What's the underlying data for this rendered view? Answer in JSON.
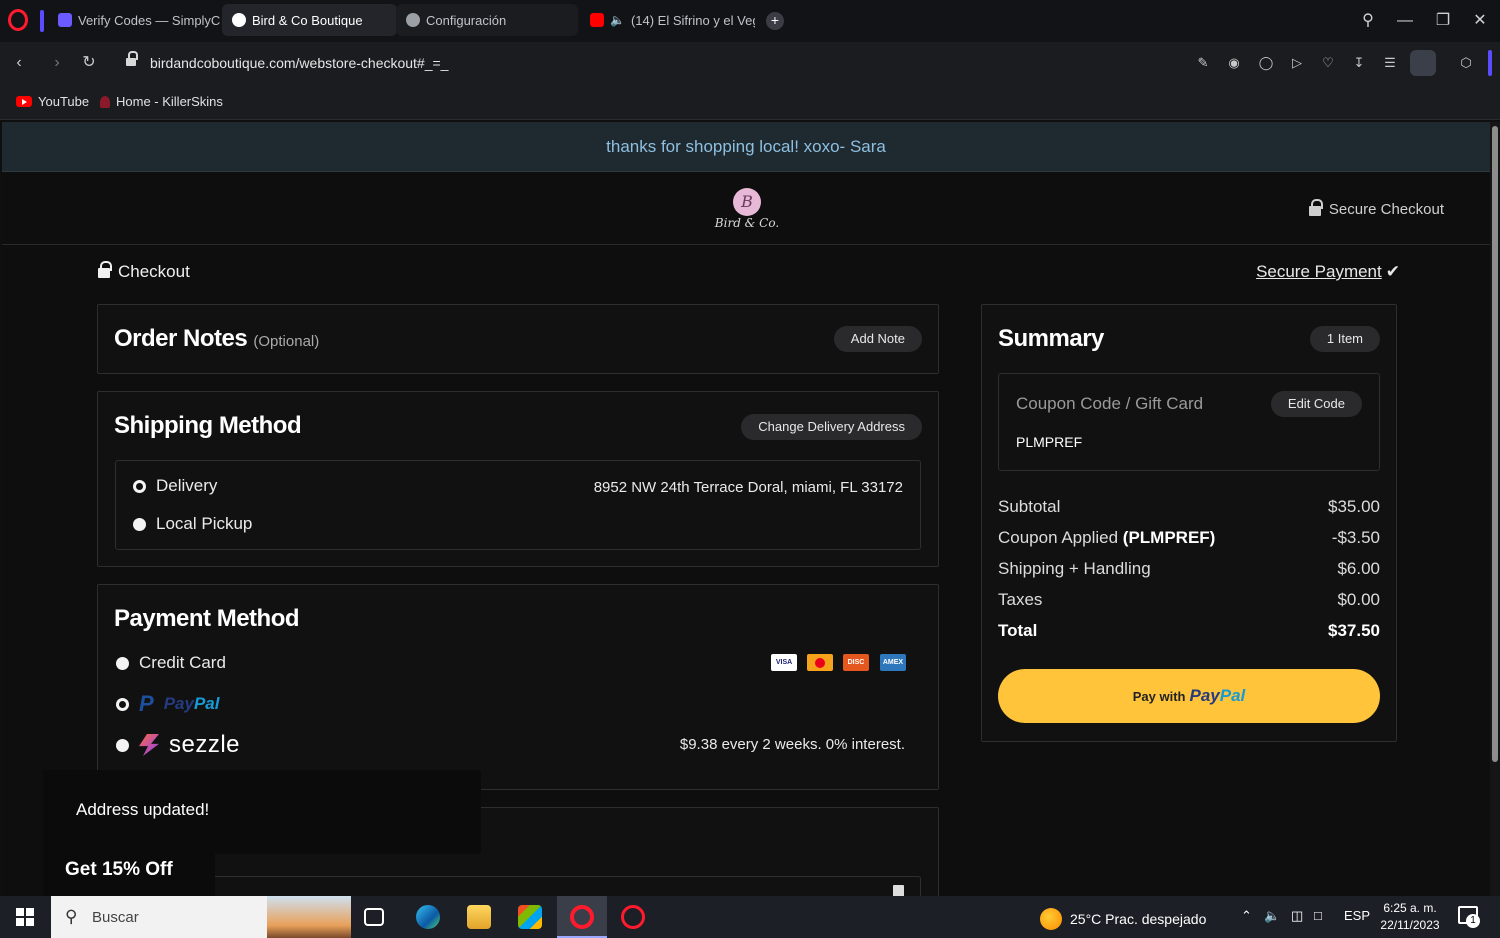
{
  "browser": {
    "tabs": [
      {
        "label": "Verify Codes — SimplyCo",
        "favicon_color": "#6b5bff"
      },
      {
        "label": "Bird & Co Boutique",
        "favicon_color": "#ffffff"
      },
      {
        "label": "Configuración",
        "favicon_color": "#9aa0a6"
      },
      {
        "label": "(14) El Sifrino y el Veg",
        "favicon_color": "#ff0000"
      }
    ],
    "url": "birdandcoboutique.com/webstore-checkout#_=_",
    "bookmarks": [
      {
        "label": "YouTube"
      },
      {
        "label": "Home - KillerSkins"
      }
    ]
  },
  "store": {
    "announcement": "thanks for shopping local! xoxo- Sara",
    "logo_initial": "B",
    "logo_text": "Bird & Co.",
    "secure_checkout": "Secure Checkout"
  },
  "checkout": {
    "title": "Checkout",
    "secure_payment": "Secure Payment",
    "order_notes": {
      "heading": "Order Notes",
      "optional": "(Optional)",
      "add_note": "Add Note"
    },
    "shipping": {
      "heading": "Shipping Method",
      "change_address": "Change Delivery Address",
      "options": [
        {
          "label": "Delivery",
          "selected": true
        },
        {
          "label": "Local Pickup",
          "selected": false
        }
      ],
      "address": "8952 NW 24th Terrace Doral, miami, FL 33172"
    },
    "payment": {
      "heading": "Payment Method",
      "credit_card": "Credit Card",
      "paypal_a": "Pay",
      "paypal_b": "Pal",
      "sezzle": "sezzle",
      "sezzle_terms": "$9.38 every 2 weeks. 0% interest.",
      "card_icons": [
        "visa-icon",
        "mastercard-icon",
        "discover-icon",
        "amex-icon"
      ]
    }
  },
  "summary": {
    "heading": "Summary",
    "item_count": "1 Item",
    "coupon_placeholder": "Coupon Code / Gift Card",
    "edit_code": "Edit Code",
    "coupon_value": "PLMPREF",
    "rows": [
      {
        "label": "Subtotal",
        "value": "$35.00"
      },
      {
        "label": "Coupon Applied",
        "code": "(PLMPREF)",
        "value": "-$3.50"
      },
      {
        "label": "Shipping + Handling",
        "value": "$6.00"
      },
      {
        "label": "Taxes",
        "value": "$0.00"
      }
    ],
    "total_label": "Total",
    "total_value": "$37.50",
    "paypal_button": {
      "prefix": "Pay with",
      "brand_a": "Pay",
      "brand_b": "Pal"
    }
  },
  "toast": "Address updated!",
  "discount_tab": "Get 15% Off",
  "taskbar": {
    "search_placeholder": "Buscar",
    "weather": "25°C  Prac. despejado",
    "language": "ESP",
    "time": "6:25 a. m.",
    "date": "22/11/2023",
    "notifications": "1"
  },
  "colors": {
    "announcement_bg": "#1e2a30",
    "announcement_text": "#8fbfe0",
    "paypal_yellow": "#ffc439",
    "opera_red": "#ff1b2d"
  }
}
